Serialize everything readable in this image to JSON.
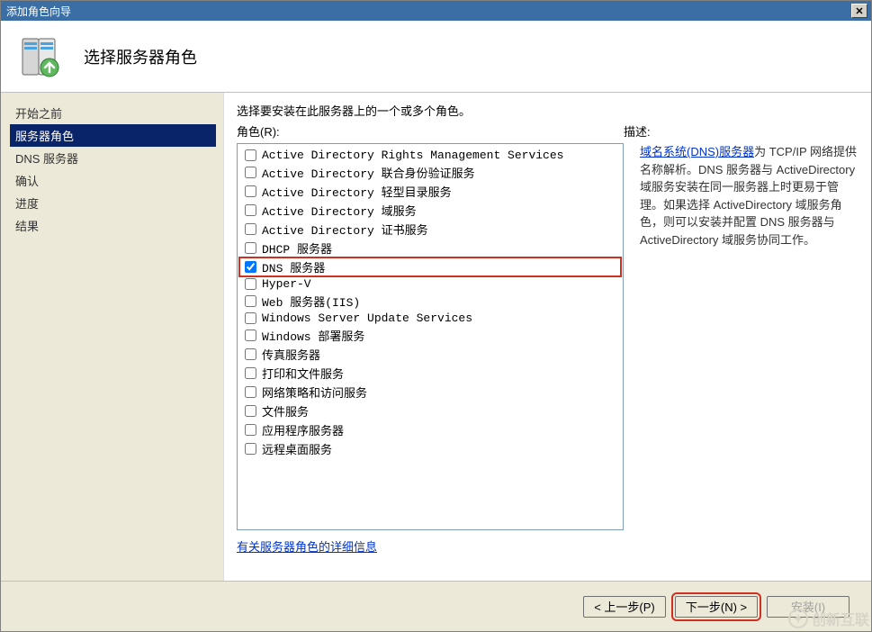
{
  "window": {
    "title": "添加角色向导"
  },
  "header": {
    "heading": "选择服务器角色"
  },
  "sidebar": {
    "items": [
      {
        "label": "开始之前",
        "selected": false
      },
      {
        "label": "服务器角色",
        "selected": true
      },
      {
        "label": "DNS 服务器",
        "selected": false
      },
      {
        "label": "确认",
        "selected": false
      },
      {
        "label": "进度",
        "selected": false
      },
      {
        "label": "结果",
        "selected": false
      }
    ]
  },
  "main": {
    "instruction": "选择要安装在此服务器上的一个或多个角色。",
    "roles_label": "角色(R):",
    "description_label": "描述:",
    "roles": [
      {
        "label": "Active Directory Rights Management Services",
        "checked": false,
        "highlight": false
      },
      {
        "label": "Active Directory 联合身份验证服务",
        "checked": false,
        "highlight": false
      },
      {
        "label": "Active Directory 轻型目录服务",
        "checked": false,
        "highlight": false
      },
      {
        "label": "Active Directory 域服务",
        "checked": false,
        "highlight": false
      },
      {
        "label": "Active Directory 证书服务",
        "checked": false,
        "highlight": false
      },
      {
        "label": "DHCP 服务器",
        "checked": false,
        "highlight": false
      },
      {
        "label": "DNS 服务器",
        "checked": true,
        "highlight": true
      },
      {
        "label": "Hyper-V",
        "checked": false,
        "highlight": false
      },
      {
        "label": "Web 服务器(IIS)",
        "checked": false,
        "highlight": false
      },
      {
        "label": "Windows Server Update Services",
        "checked": false,
        "highlight": false
      },
      {
        "label": "Windows 部署服务",
        "checked": false,
        "highlight": false
      },
      {
        "label": "传真服务器",
        "checked": false,
        "highlight": false
      },
      {
        "label": "打印和文件服务",
        "checked": false,
        "highlight": false
      },
      {
        "label": "网络策略和访问服务",
        "checked": false,
        "highlight": false
      },
      {
        "label": "文件服务",
        "checked": false,
        "highlight": false
      },
      {
        "label": "应用程序服务器",
        "checked": false,
        "highlight": false
      },
      {
        "label": "远程桌面服务",
        "checked": false,
        "highlight": false
      }
    ],
    "roles_more_link": "有关服务器角色的详细信息",
    "description": {
      "link_text": "域名系统(DNS)服务器",
      "body": "为 TCP/IP 网络提供名称解析。DNS 服务器与 ActiveDirectory 域服务安装在同一服务器上时更易于管理。如果选择 ActiveDirectory 域服务角色，则可以安装并配置 DNS 服务器与 ActiveDirectory 域服务协同工作。"
    }
  },
  "footer": {
    "prev": "< 上一步(P)",
    "next": "下一步(N) >",
    "install": "安装(I)"
  },
  "watermark": "创新互联"
}
